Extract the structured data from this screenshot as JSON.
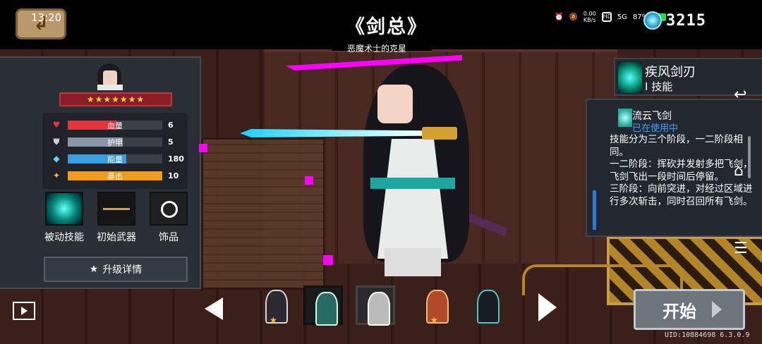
{
  "status_bar": {
    "time": "13:20",
    "net_speed": "0.00\nKB/s",
    "signal": "5G",
    "battery_percent": "87%"
  },
  "currency": {
    "gems": "3215"
  },
  "hero": {
    "title": "《剑总》",
    "subtitle": "恶魔术士的克星",
    "stars": "★★★★★★★",
    "stats": [
      {
        "label": "血量",
        "value": "6",
        "icon": "heart-icon",
        "color": "#e0353d",
        "fill": 0.52
      },
      {
        "label": "护甲",
        "value": "5",
        "icon": "shield-icon",
        "color": "#8a96a8",
        "fill": 0.58
      },
      {
        "label": "能量",
        "value": "180",
        "icon": "energy-gem-icon",
        "color": "#3a9ee0",
        "fill": 0.62
      },
      {
        "label": "暴击",
        "value": "10",
        "icon": "crit-sword-icon",
        "color": "#f29a1a",
        "fill": 1.0
      }
    ],
    "equipment": [
      {
        "label": "被动技能",
        "icon": "passive-skill-icon"
      },
      {
        "label": "初始武器",
        "icon": "sword-weapon-icon"
      },
      {
        "label": "饰品",
        "icon": "ring-accessory-icon"
      }
    ],
    "upgrade_label": "升级详情"
  },
  "skill": {
    "name": "疾风剑刃",
    "type": "I 技能",
    "detail_name": "流云飞剑",
    "detail_status": "已在使用中",
    "description": "技能分为三个阶段，一二阶段相同。\n一二阶段：挥砍并发射多把飞剑，飞剑飞出一段时间后停留。\n三阶段：向前突进，对经过区域进行多次斩击，同时召回所有飞剑。"
  },
  "bottom": {
    "start_label": "开始",
    "uid": "UID:10884698 6.3.0.9"
  },
  "colors": {
    "magenta_glitch": "#ff00ff",
    "sword_blue": "#1cd0ff",
    "status_blue": "#3fa0ff"
  }
}
